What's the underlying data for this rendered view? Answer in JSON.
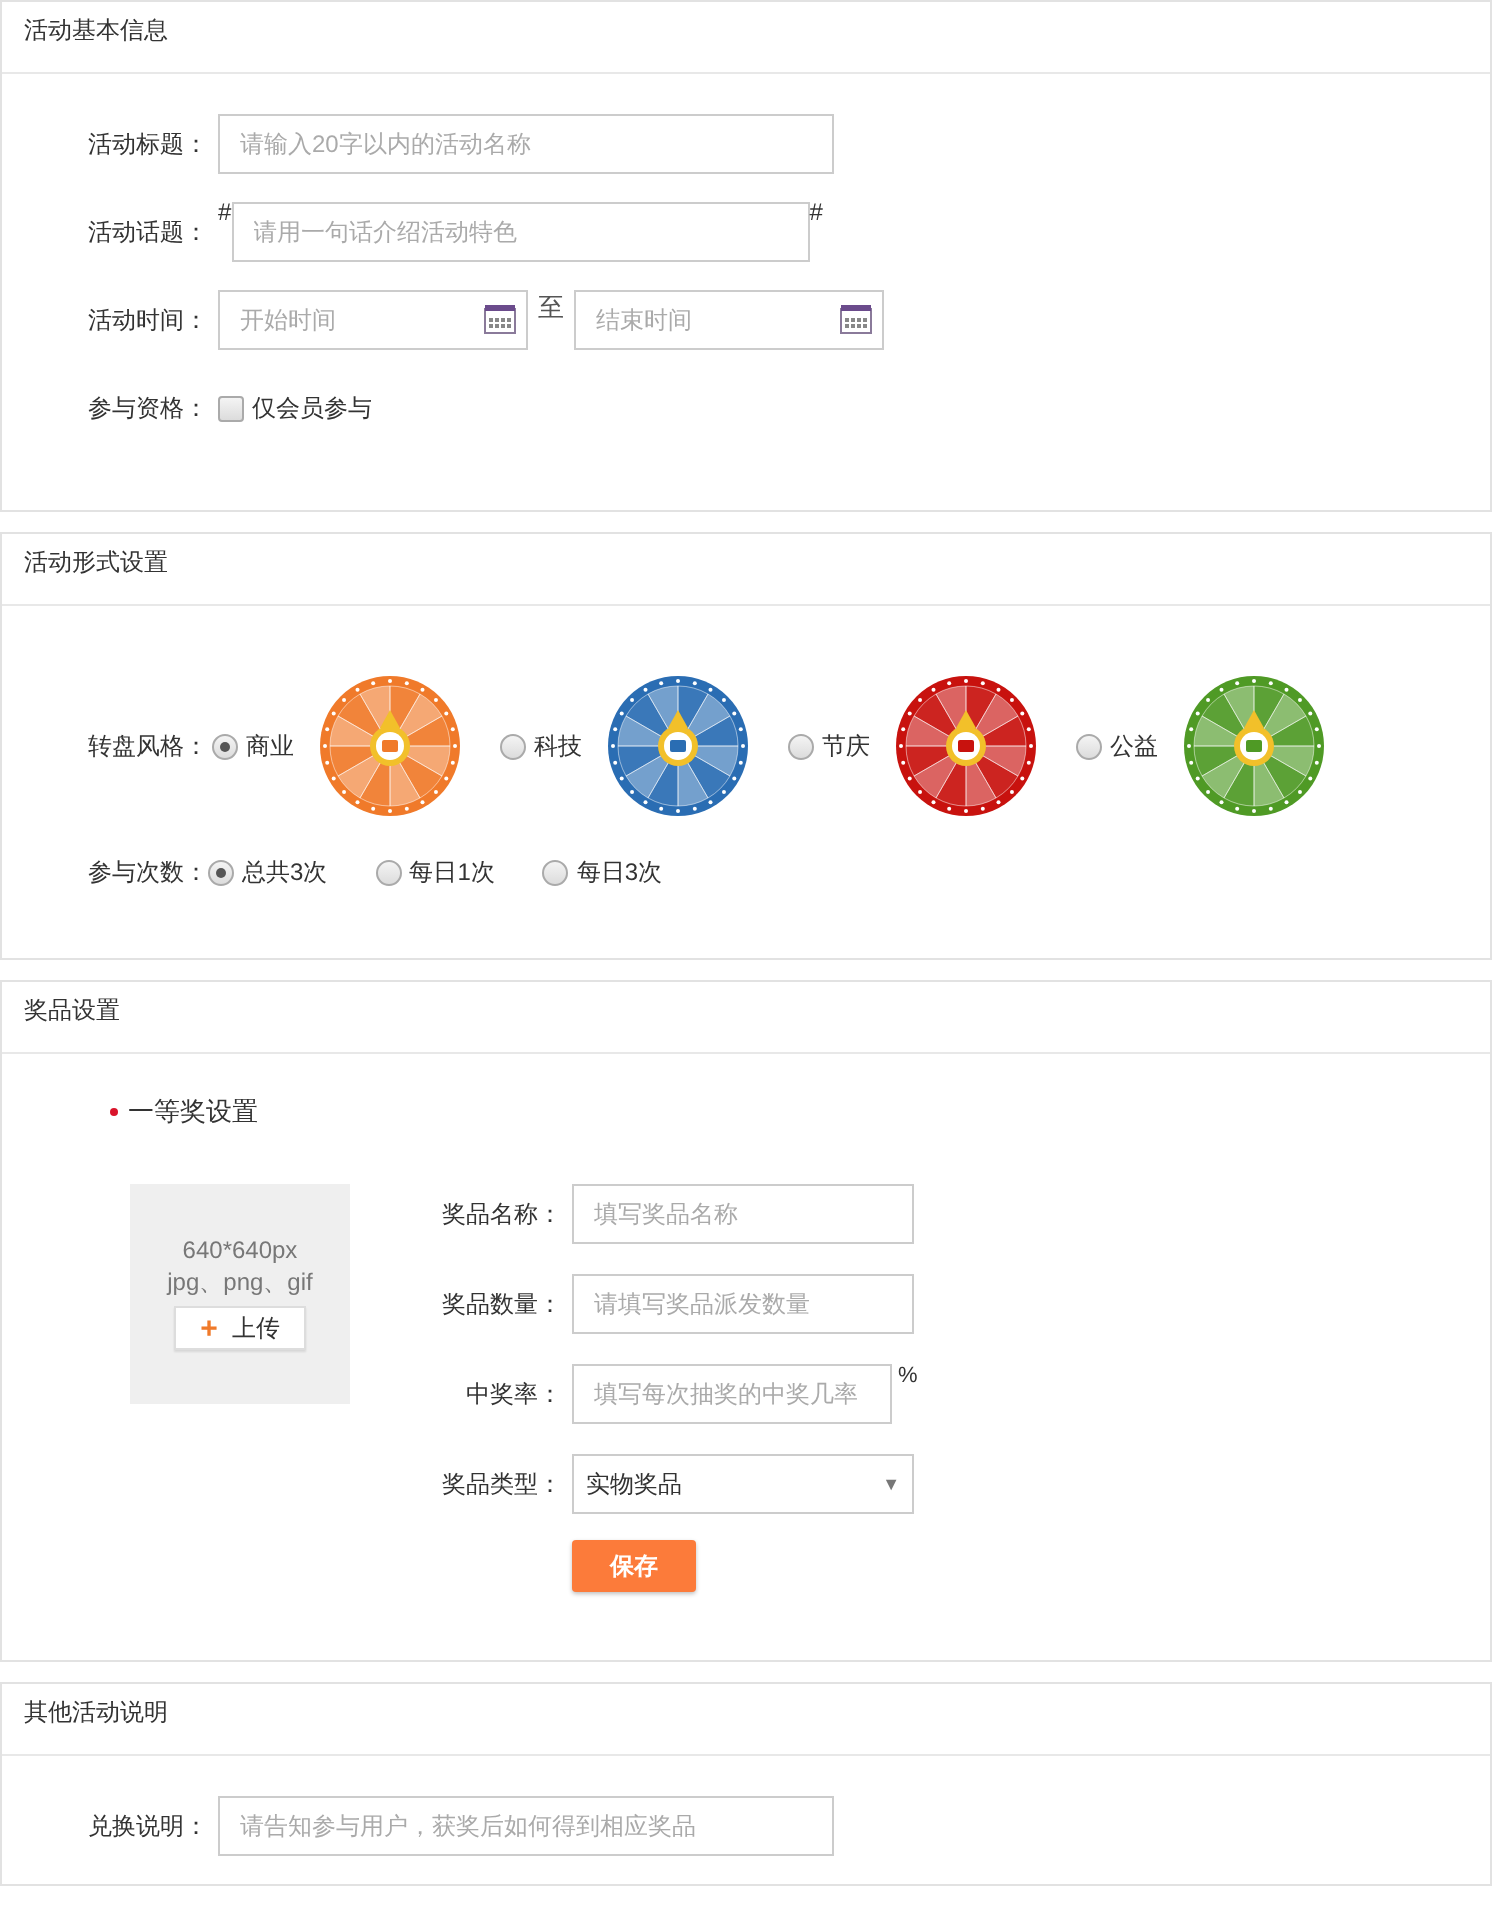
{
  "sections": [
    {
      "kind": "basic",
      "title": "活动基本信息",
      "fields": [
        {
          "kind": "text",
          "label": "活动标题：",
          "placeholder": "请输入20字以内的活动名称"
        },
        {
          "kind": "topic",
          "label": "活动话题：",
          "prefix": "#",
          "placeholder": "请用一句话介绍活动特色",
          "suffix": "#"
        },
        {
          "kind": "daterange",
          "label": "活动时间：",
          "start_placeholder": "开始时间",
          "separator": "至",
          "end_placeholder": "结束时间"
        },
        {
          "kind": "checkbox",
          "label": "参与资格：",
          "option": "仅会员参与",
          "checked": false
        }
      ]
    },
    {
      "kind": "format",
      "title": "活动形式设置",
      "fields": [
        {
          "kind": "wheels",
          "label": "转盘风格：",
          "options": [
            {
              "label": "商业",
              "selected": true,
              "color": "#f07a2a"
            },
            {
              "label": "科技",
              "selected": false,
              "color": "#2a6db3"
            },
            {
              "label": "节庆",
              "selected": false,
              "color": "#c8120e"
            },
            {
              "label": "公益",
              "selected": false,
              "color": "#4f9a25"
            }
          ]
        },
        {
          "kind": "radios",
          "label": "参与次数：",
          "options": [
            {
              "label": "总共3次",
              "selected": true
            },
            {
              "label": "每日1次",
              "selected": false
            },
            {
              "label": "每日3次",
              "selected": false
            }
          ]
        }
      ]
    },
    {
      "kind": "prizes",
      "title": "奖品设置",
      "prize_title": "一等奖设置",
      "upload": {
        "size": "640*640px",
        "formats": "jpg、png、gif",
        "plus": "+",
        "button": "上传"
      },
      "fields": [
        {
          "kind": "text",
          "label": "奖品名称：",
          "placeholder": "填写奖品名称"
        },
        {
          "kind": "text",
          "label": "奖品数量：",
          "placeholder": "请填写奖品派发数量"
        },
        {
          "kind": "percent",
          "label": "中奖率：",
          "placeholder": "填写每次抽奖的中奖几率",
          "suffix": "%"
        },
        {
          "kind": "select",
          "label": "奖品类型：",
          "value": "实物奖品",
          "arrow": "▼"
        }
      ],
      "save": "保存"
    },
    {
      "kind": "other",
      "title": "其他活动说明",
      "fields": [
        {
          "kind": "text",
          "label": "兑换说明：",
          "placeholder": "请告知参与用户，获奖后如何得到相应奖品"
        }
      ]
    }
  ]
}
